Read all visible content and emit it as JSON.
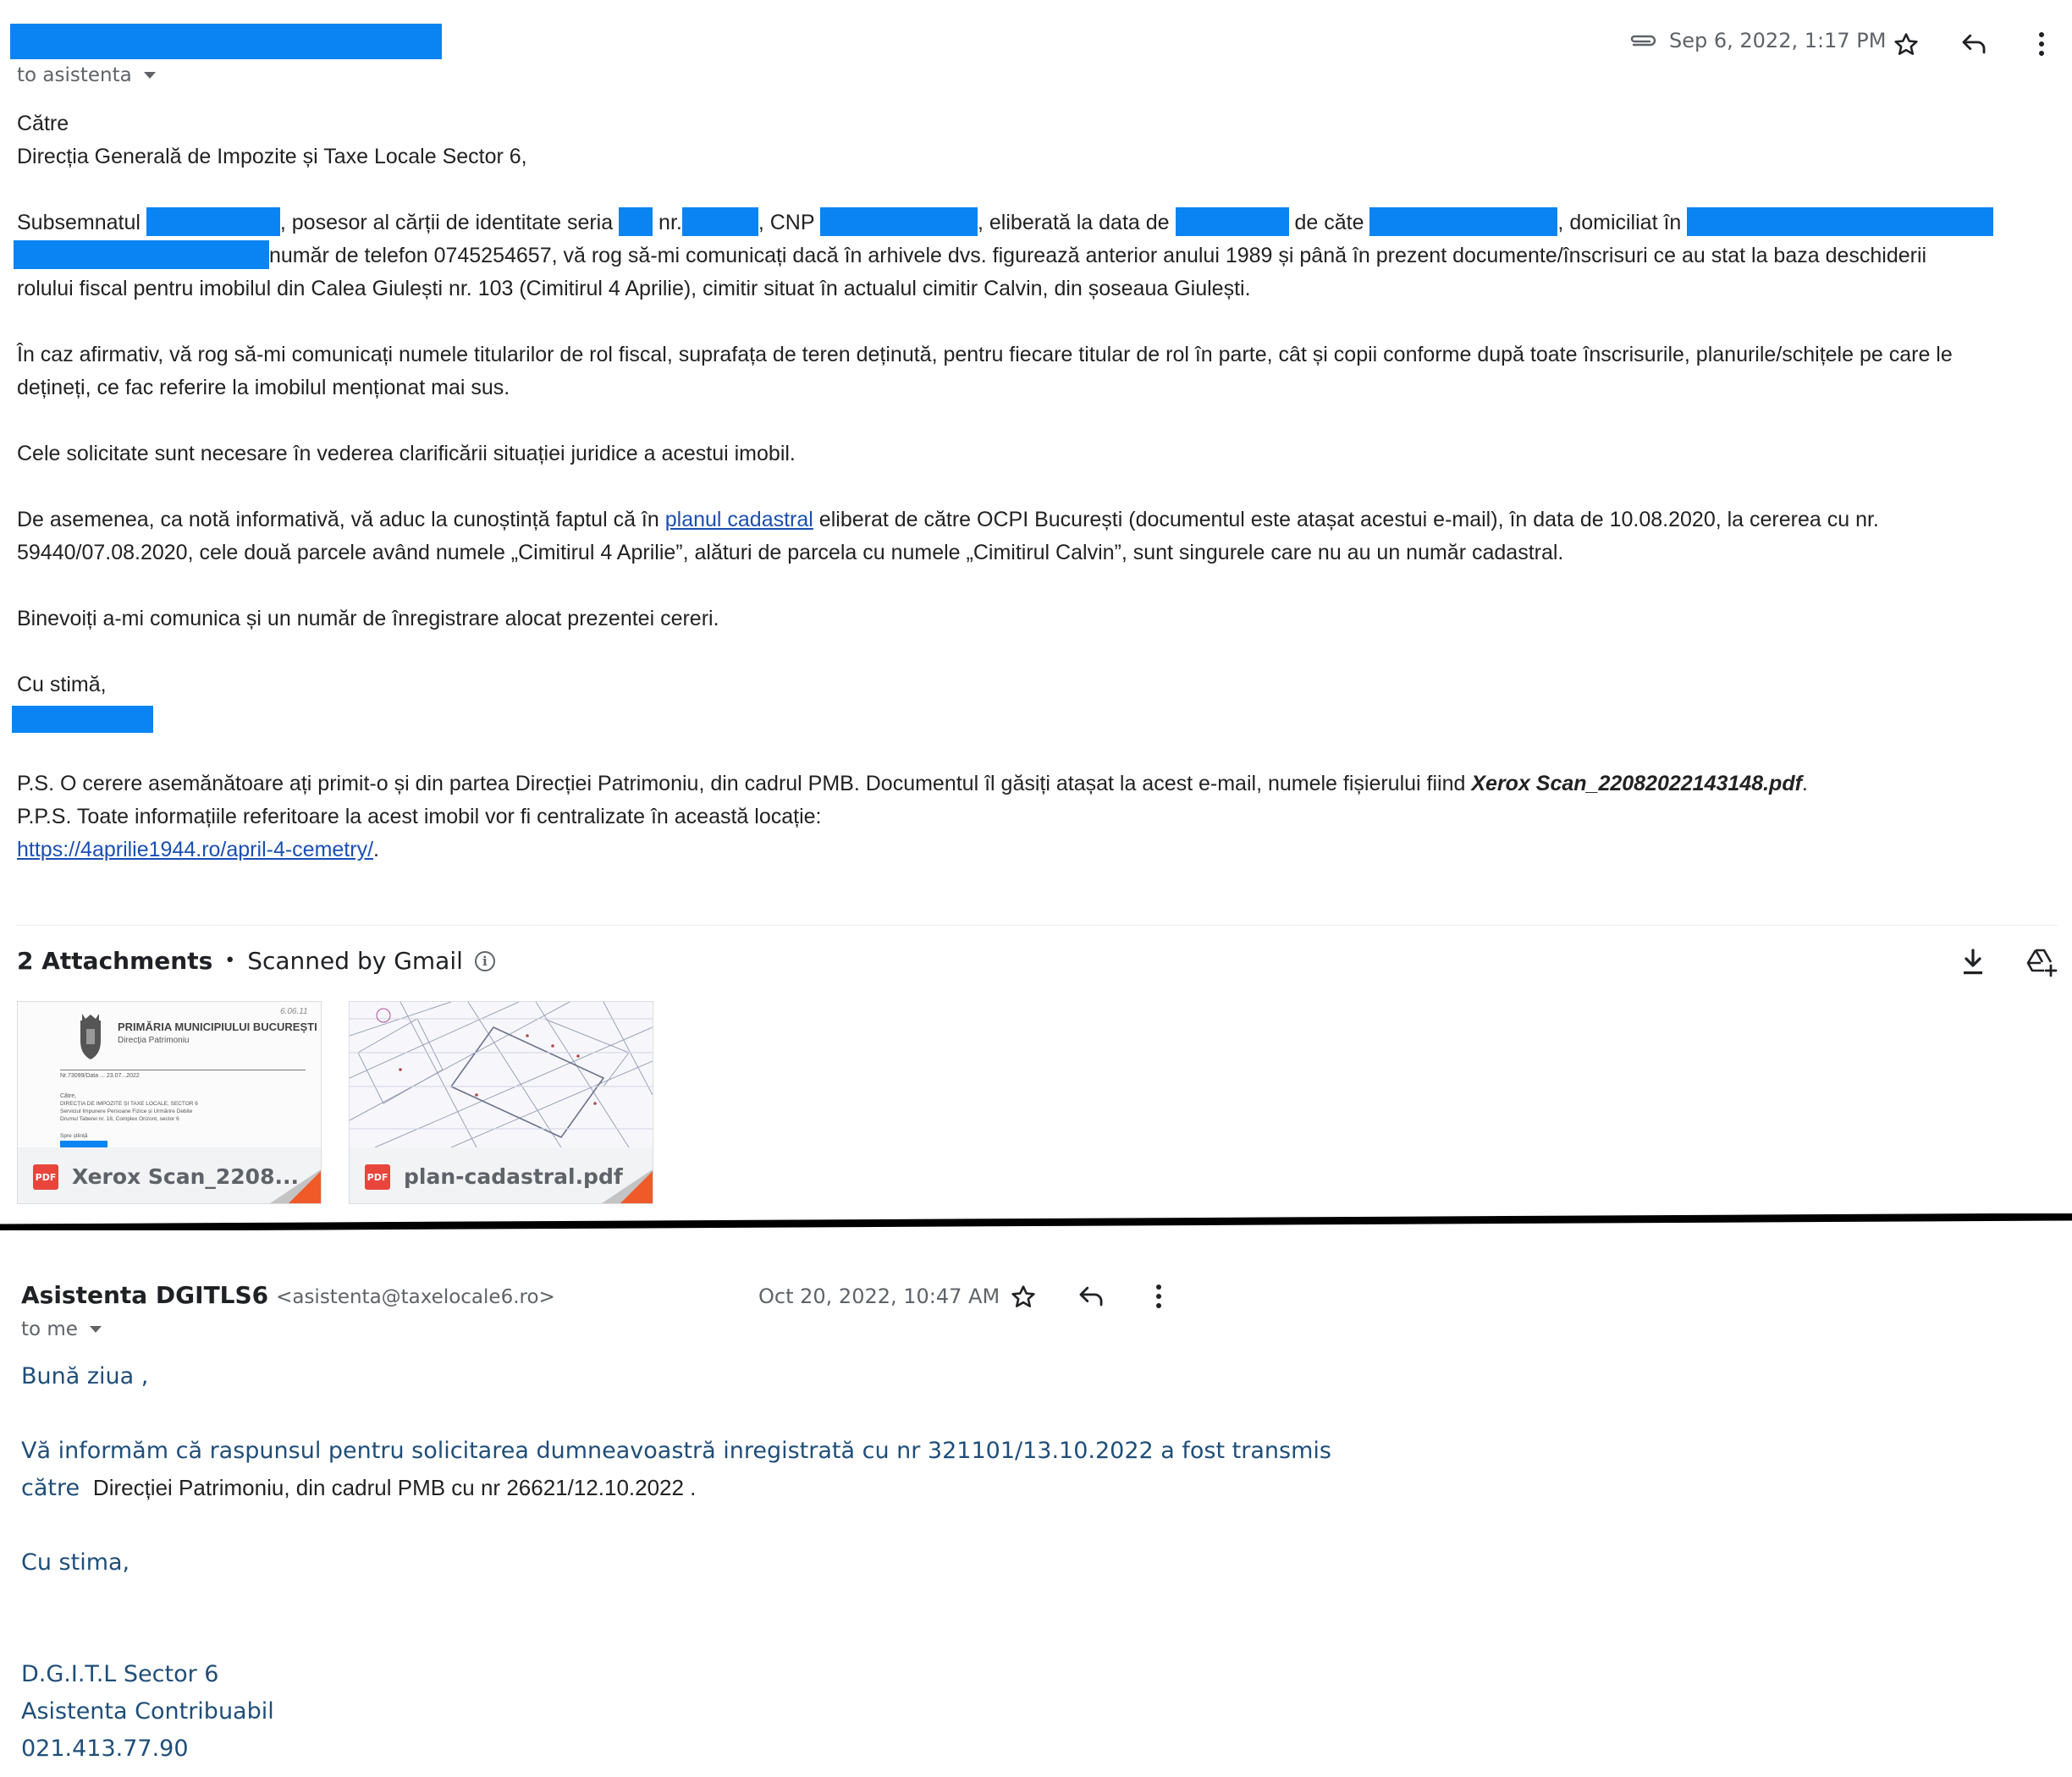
{
  "email1": {
    "recipient_line": "to asistenta",
    "date": "Sep 6, 2022, 1:17 PM",
    "icons": {
      "attachment": "paperclip-icon",
      "star": "star-icon",
      "reply": "reply-icon",
      "more": "more-vert-icon"
    },
    "body": {
      "salutation1": "Către",
      "salutation2": "Direcția Generală de Impozite și Taxe Locale Sector 6,",
      "p1_a": "Subsemnatul ",
      "p1_b": ", posesor al cărții de identitate seria ",
      "p1_c": " nr.",
      "p1_d": ", CNP ",
      "p1_e": ", eliberată la data de ",
      "p1_f": " de căte ",
      "p1_g": ", domiciliat în ",
      "p1_line2": "număr de telefon 0745254657, vă rog să-mi comunicați dacă în arhivele dvs. figurează anterior anului 1989 și până în prezent documente/înscrisuri ce au stat la baza deschiderii",
      "p1_line3": "rolului fiscal pentru imobilul din Calea Giulești nr. 103 (Cimitirul 4 Aprilie), cimitir situat în actualul cimitir Calvin, din șoseaua Giulești.",
      "p2_line1": "În caz afirmativ, vă rog să-mi comunicați numele titularilor de rol fiscal, suprafața de teren deținută, pentru fiecare titular de rol în parte, cât și copii conforme după toate înscrisurile, planurile/schițele pe care le",
      "p2_line2": "dețineți, ce fac referire la imobilul menționat mai sus.",
      "p3": "Cele solicitate sunt necesare în vederea clarificării situației juridice a acestui imobil.",
      "p4_a": "De asemenea, ca notă informativă, vă aduc la cunoștință faptul că în ",
      "p4_link": "planul cadastral",
      "p4_b": " eliberat de către OCPI București (documentul este atașat acestui e-mail), în data de 10.08.2020, la cererea cu nr.",
      "p4_line2": "59440/07.08.2020, cele două parcele având numele „Cimitirul 4 Aprilie”, alături de parcela cu numele „Cimitirul Calvin”, sunt singurele care nu au un număr cadastral.",
      "p5": "Binevoiți a-mi comunica și un număr de înregistrare alocat prezentei cereri.",
      "closing": "Cu stimă,",
      "ps_a": "P.S. O cerere asemănătoare ați primit-o și din partea Direcției Patrimoniu, din cadrul PMB. Documentul îl găsiți atașat la acest e-mail, numele fișierului fiind ",
      "ps_file": "Xerox Scan_22082022143148.pdf",
      "ps_end": ".",
      "pps": "P.P.S. Toate informațiile referitoare la acest imobil vor fi centralizate în această locație:",
      "pps_link": "https://4aprilie1944.ro/april-4-cemetry/",
      "pps_end": "."
    },
    "attachments": {
      "count_label": "2 Attachments",
      "separator": "•",
      "scanned_label": "Scanned by Gmail",
      "icons": {
        "info": "info-icon",
        "download": "download-icon",
        "drive": "add-to-drive-icon"
      },
      "items": [
        {
          "name": "Xerox Scan_2208...",
          "type_badge": "PDF",
          "thumb_heading": "PRIMĂRIA MUNICIPIULUI BUCUREȘTI",
          "thumb_sub": "Direcția Patrimoniu",
          "thumb_stamp": "6.06.11",
          "thumb_nr": "Nr.73099/Data ... 23.07...2022",
          "thumb_to": "Către,",
          "thumb_l1": "DIRECȚIA DE IMPOZITE ȘI TAXE LOCALE, SECTOR 6",
          "thumb_l2": "Serviciul Impunere Persoane Fizice și Urmărire Debite",
          "thumb_l3": "Drumul Taberei nr. 18, Complex Orizont, sector 6",
          "thumb_sig": "Spre știință"
        },
        {
          "name": "plan-cadastral.pdf",
          "type_badge": "PDF"
        }
      ]
    }
  },
  "email2": {
    "sender_name": "Asistenta DGITLS6",
    "sender_email": "<asistenta@taxelocale6.ro>",
    "recipient_line": "to me",
    "date": "Oct 20, 2022, 10:47 AM",
    "body": {
      "greeting": "Bună ziua ,",
      "line1": "Vă informăm că raspunsul pentru solicitarea dumneavoastră inregistrată cu nr 321101/13.10.2022 a fost transmis",
      "line2_a": "către ",
      "line2_b": " Direcției Patrimoniu, din cadrul PMB cu nr 26621/12.10.2022 .",
      "closing": "Cu stima,",
      "sig1": "D.G.I.T.L Sector 6",
      "sig2": "Asistenta Contribuabil",
      "sig3": "021.413.77.90"
    }
  },
  "colors": {
    "redaction": "#0a84f2",
    "link": "#1a4fb3",
    "reply_text": "#1f4e79",
    "pdf_red": "#e8453c"
  }
}
